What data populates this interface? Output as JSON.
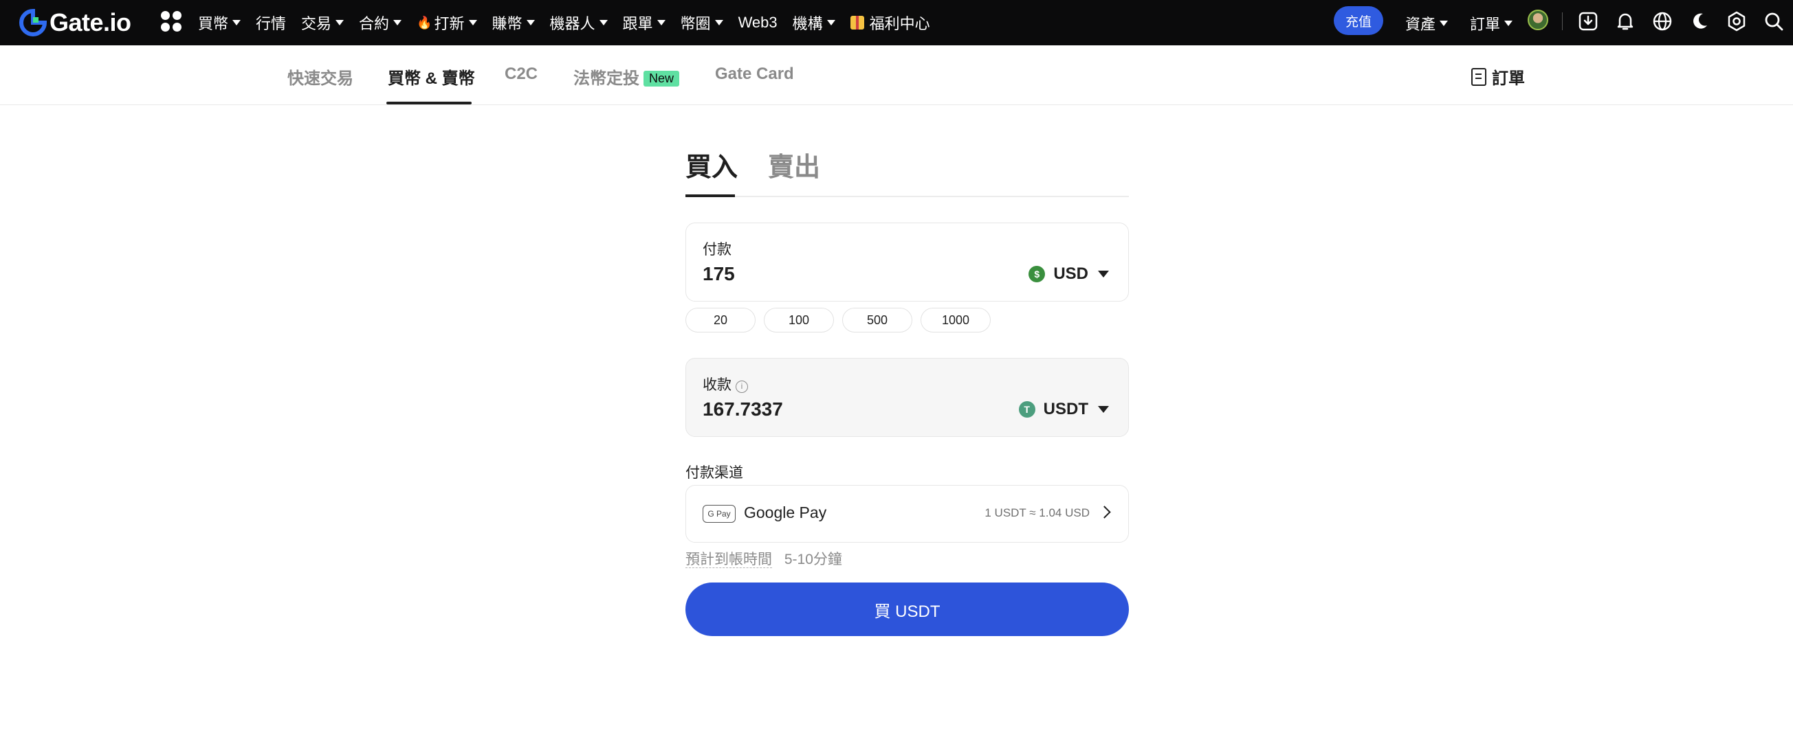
{
  "topnav": {
    "logo_text": "Gate.io",
    "items": [
      {
        "label": "買幣",
        "caret": true
      },
      {
        "label": "行情",
        "caret": false
      },
      {
        "label": "交易",
        "caret": true
      },
      {
        "label": "合約",
        "caret": true
      },
      {
        "label": "打新",
        "caret": true,
        "fire": true
      },
      {
        "label": "賺幣",
        "caret": true
      },
      {
        "label": "機器人",
        "caret": true
      },
      {
        "label": "跟單",
        "caret": true
      },
      {
        "label": "幣圈",
        "caret": true
      },
      {
        "label": "Web3",
        "caret": false
      },
      {
        "label": "機構",
        "caret": true
      },
      {
        "label": "福利中心",
        "caret": false,
        "gift": true
      }
    ],
    "deposit_label": "充值",
    "assets_label": "資產",
    "orders_label": "訂單",
    "accent_color": "#2f5be0",
    "icons": [
      "download-icon",
      "bell-icon",
      "globe-icon",
      "moon-icon",
      "settings-icon",
      "search-icon"
    ]
  },
  "subnav": {
    "tabs": [
      "快速交易",
      "買幣 & 賣幣",
      "C2C",
      "法幣定投",
      "Gate Card"
    ],
    "active_tab": "買幣 & 賣幣",
    "new_badge": "New",
    "orders_link": "訂單"
  },
  "form": {
    "tabs": [
      "買入",
      "賣出"
    ],
    "active_tab": "買入",
    "pay": {
      "label": "付款",
      "amount": "175",
      "currency": "USD",
      "coin_symbol": "$",
      "coin_color": "#3a8f3e"
    },
    "quick_amounts": [
      "20",
      "100",
      "500",
      "1000"
    ],
    "receive": {
      "label": "收款",
      "amount": "167.7337",
      "currency": "USDT",
      "coin_symbol": "T",
      "coin_color": "#4c9e7e"
    },
    "payment_channel": {
      "title": "付款渠道",
      "logo_text": "G Pay",
      "name": "Google Pay",
      "rate": "1 USDT ≈ 1.04 USD"
    },
    "eta": {
      "label": "預計到帳時間",
      "value": "5-10分鐘"
    },
    "buy_button": "買  USDT",
    "button_color": "#2d54da"
  }
}
